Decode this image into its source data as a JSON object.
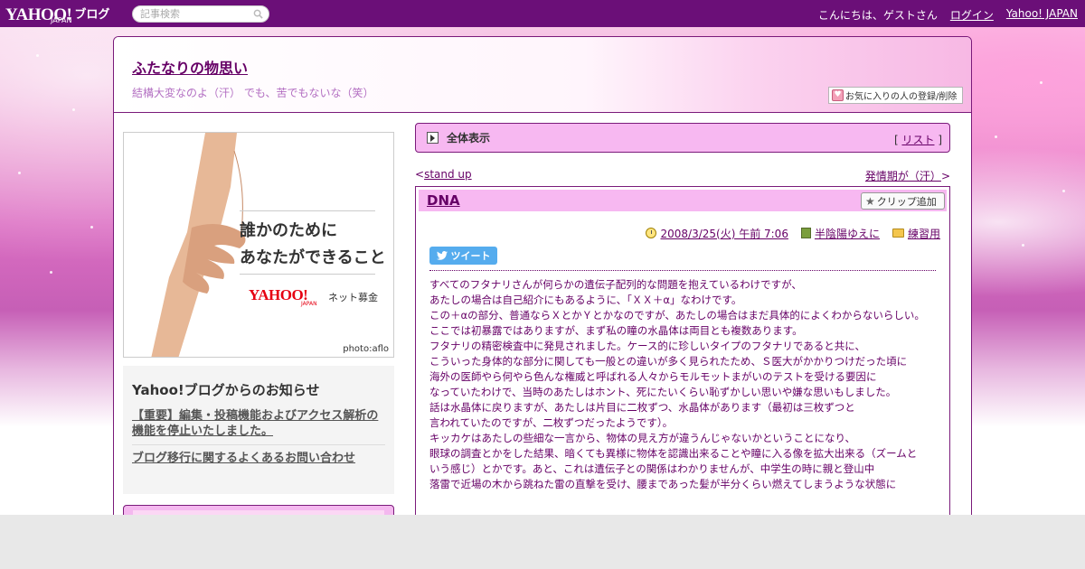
{
  "masthead": {
    "logo": "YAHOO!",
    "logo_sub": "JAPAN",
    "logo_blog": "ブログ",
    "search_placeholder": "記事検索",
    "greeting": "こんにちは、ゲストさん",
    "login": "ログイン",
    "yahoo_japan": "Yahoo! JAPAN"
  },
  "blog": {
    "title": "ふたなりの物思い",
    "description": "結構大変なのよ（汗） でも、苦でもないな（笑）",
    "favorite_button": "お気に入りの人の登録/削除"
  },
  "banner": {
    "line1": "誰かのために",
    "line2": "あなたができること",
    "brand": "YAHOO!",
    "brand_sub": "JAPAN",
    "net_donation": "ネット募金",
    "credit": "photo:aflo"
  },
  "notice": {
    "title": "Yahoo!ブログからのお知らせ",
    "links": [
      "【重要】編集・投稿機能およびアクセス解析の機能を停止いたしました。",
      "ブログ移行に関するよくあるお問い合わせ"
    ]
  },
  "entry_bar": {
    "label": "全体表示",
    "list_open": "[",
    "list_link": "リスト",
    "list_close": "]"
  },
  "nav": {
    "prev_arrow": "<",
    "prev": "stand up",
    "next": "発情期が（汗）",
    "next_arrow": ">"
  },
  "article": {
    "title": "DNA",
    "clip_button": "クリップ追加",
    "date": "2008/3/25(火) 午前 7:06",
    "author": "半陰陽ゆえに",
    "category": "練習用",
    "tweet": "ツイート",
    "body": [
      "すべてのフタナリさんが何らかの遺伝子配列的な問題を抱えているわけですが、",
      "あたしの場合は自己紹介にもあるように、「ＸＸ＋α」なわけです。",
      "この＋αの部分、普通ならＸとかＹとかなのですが、あたしの場合はまだ具体的によくわからないらしい。",
      "ここでは初暴露ではありますが、まず私の瞳の水晶体は両目とも複数あります。",
      "フタナリの精密検査中に発見されました。ケース的に珍しいタイプのフタナリであると共に、",
      "こういった身体的な部分に関しても一般との違いが多く見られたため、Ｓ医大がかかりつけだった頃に",
      "海外の医師やら何やら色んな権威と呼ばれる人々からモルモットまがいのテストを受ける要因に",
      "なっていたわけで、当時のあたしはホント、死にたいくらい恥ずかしい思いや嫌な思いもしました。",
      "話は水晶体に戻りますが、あたしは片目に二枚ずつ、水晶体があります（最初は三枚ずつと",
      "言われていたのですが、二枚ずつだったようです）。",
      "キッカケはあたしの些細な一言から、物体の見え方が違うんじゃないかということになり、",
      "眼球の調査とかをした結果、暗くても異様に物体を認識出来ることや瞳に入る像を拡大出来る（ズームと",
      "いう感じ）とかです。あと、これは遺伝子との関係はわかりませんが、中学生の時に親と登山中",
      "落雷で近場の木から跳ねた雷の直撃を受け、腰まであった髪が半分くらい燃えてしまうような状態に"
    ]
  }
}
